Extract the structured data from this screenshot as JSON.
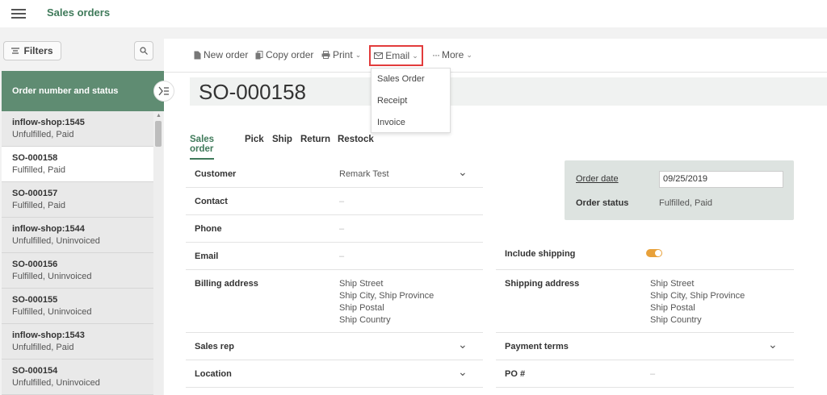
{
  "app": {
    "title": "Sales orders"
  },
  "left_panel": {
    "filters_label": "Filters",
    "list_header": "Order number and status",
    "orders": [
      {
        "number": "inflow-shop:1545",
        "status": "Unfulfilled, Paid"
      },
      {
        "number": "SO-000158",
        "status": "Fulfilled, Paid",
        "active": true
      },
      {
        "number": "SO-000157",
        "status": "Fulfilled, Paid"
      },
      {
        "number": "inflow-shop:1544",
        "status": "Unfulfilled, Uninvoiced"
      },
      {
        "number": "SO-000156",
        "status": "Fulfilled, Uninvoiced"
      },
      {
        "number": "SO-000155",
        "status": "Fulfilled, Uninvoiced"
      },
      {
        "number": "inflow-shop:1543",
        "status": "Unfulfilled, Paid"
      },
      {
        "number": "SO-000154",
        "status": "Unfulfilled, Uninvoiced"
      }
    ]
  },
  "toolbar": {
    "new_order": "New order",
    "copy_order": "Copy order",
    "print": "Print",
    "email": "Email",
    "more": "More"
  },
  "email_menu": [
    "Sales Order",
    "Receipt",
    "Invoice"
  ],
  "order": {
    "number": "SO-000158",
    "tabs": [
      "Sales order",
      "Pick",
      "Ship",
      "Return",
      "Restock"
    ],
    "customer_label": "Customer",
    "customer_value": "Remark Test",
    "contact_label": "Contact",
    "phone_label": "Phone",
    "email_label": "Email",
    "empty_value": "–",
    "billing_label": "Billing address",
    "billing_lines": [
      "Ship Street",
      "Ship City, Ship Province",
      "Ship Postal",
      "Ship Country"
    ],
    "sales_rep_label": "Sales rep",
    "location_label": "Location",
    "order_date_label": "Order date",
    "order_date_value": "09/25/2019",
    "order_status_label": "Order status",
    "order_status_value": "Fulfilled, Paid",
    "include_shipping_label": "Include shipping",
    "include_shipping_on": true,
    "shipping_label": "Shipping address",
    "shipping_lines": [
      "Ship Street",
      "Ship City, Ship Province",
      "Ship Postal",
      "Ship Country"
    ],
    "payment_terms_label": "Payment terms",
    "po_label": "PO #"
  },
  "colors": {
    "accent": "#3f7a5a",
    "header": "#5f8c72",
    "highlight": "#e23b3b",
    "toggle": "#e8a13a"
  }
}
